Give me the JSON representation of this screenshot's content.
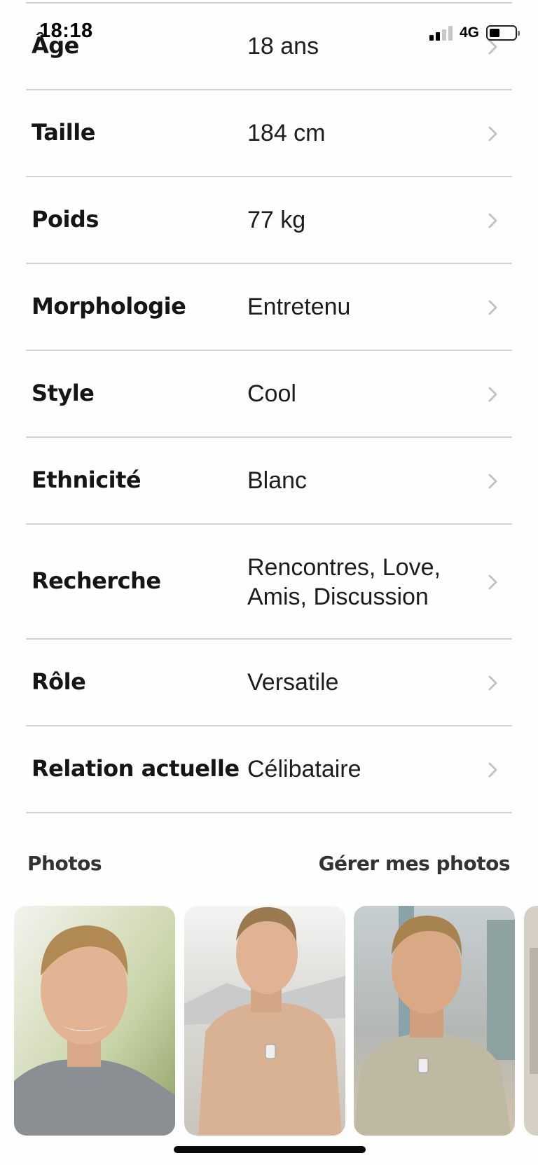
{
  "status_bar": {
    "time": "18:18",
    "network": "4G"
  },
  "rows": [
    {
      "label": "Âge",
      "value": "18 ans"
    },
    {
      "label": "Taille",
      "value": "184 cm"
    },
    {
      "label": "Poids",
      "value": "77 kg"
    },
    {
      "label": "Morphologie",
      "value": "Entretenu"
    },
    {
      "label": "Style",
      "value": "Cool"
    },
    {
      "label": "Ethnicité",
      "value": "Blanc"
    },
    {
      "label": "Recherche",
      "value": "Rencontres, Love, Amis, Discussion"
    },
    {
      "label": "Rôle",
      "value": "Versatile"
    },
    {
      "label": "Relation actuelle",
      "value": "Célibataire"
    }
  ],
  "photos": {
    "title": "Photos",
    "manage_label": "Gérer mes photos"
  },
  "colors": {
    "chevron": "#c4c4c4",
    "divider": "#d3d3d3"
  }
}
